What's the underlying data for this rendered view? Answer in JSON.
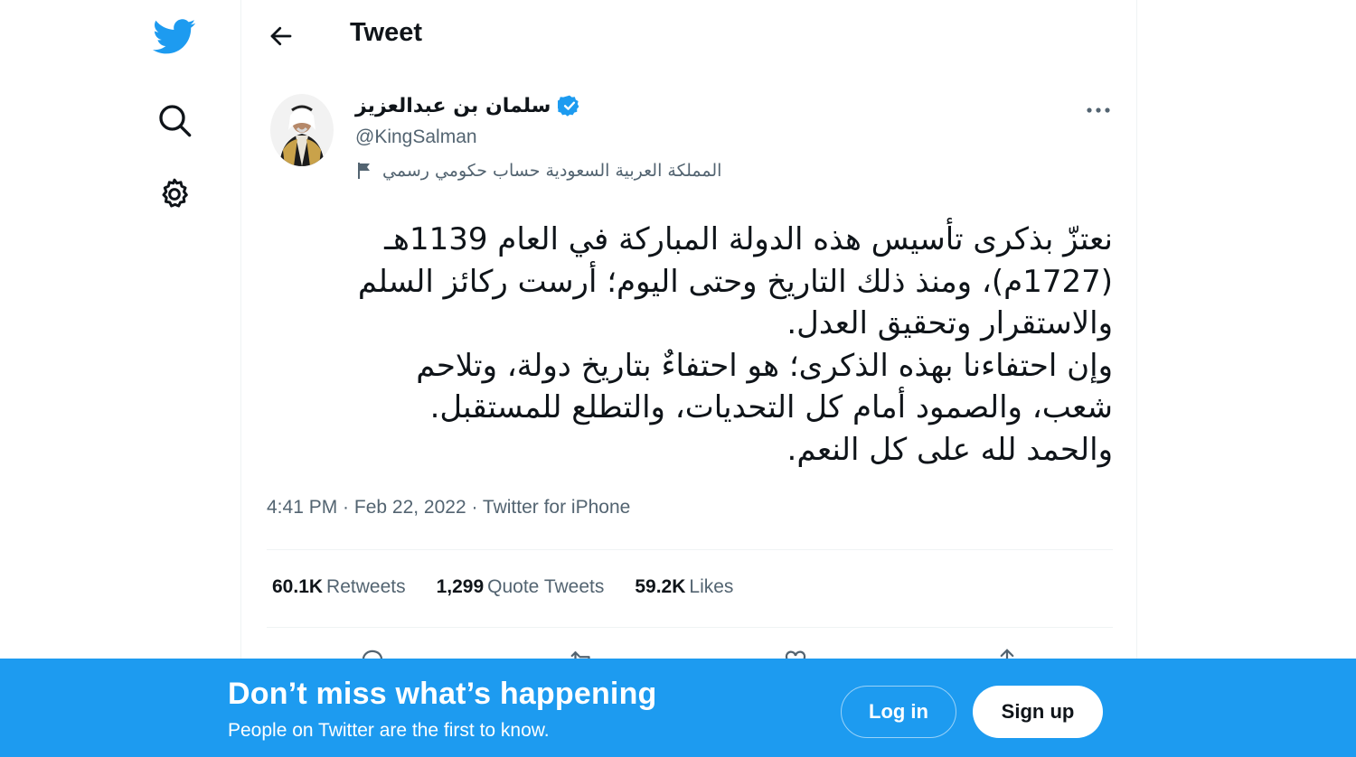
{
  "nav": {
    "logo_icon": "twitter-bird-icon",
    "search_icon": "search-icon",
    "settings_icon": "gear-icon",
    "brand_color": "#1d9bf0"
  },
  "header": {
    "back_icon": "back-arrow-icon",
    "title": "Tweet"
  },
  "tweet": {
    "author": {
      "name": "سلمان بن عبدالعزيز",
      "verified": true,
      "handle": "@KingSalman",
      "label": "المملكة العربية السعودية حساب حكومي رسمي"
    },
    "text_lines": [
      "نعتزّ بذكرى تأسيس هذه الدولة المباركة في العام 1139هـ",
      "(1727م)، ومنذ ذلك التاريخ وحتى اليوم؛ أرست ركائز السلم",
      "والاستقرار وتحقيق العدل.",
      "وإن احتفاءنا بهذه الذكرى؛ هو احتفاءٌ بتاريخ دولة، وتلاحم",
      "شعب، والصمود أمام كل التحديات، والتطلع للمستقبل.",
      "والحمد لله على كل النعم."
    ],
    "meta": "4:41 PM · Feb 22, 2022 · Twitter for iPhone",
    "stats": {
      "retweets_count": "60.1K",
      "retweets_label": "Retweets",
      "quotes_count": "1,299",
      "quotes_label": "Quote Tweets",
      "likes_count": "59.2K",
      "likes_label": "Likes"
    },
    "actions": [
      "reply-icon",
      "retweet-icon",
      "like-icon",
      "share-icon"
    ]
  },
  "banner": {
    "title": "Don’t miss what’s happening",
    "subtitle": "People on Twitter are the first to know.",
    "login_label": "Log in",
    "signup_label": "Sign up",
    "background_color": "#1d9bf0"
  }
}
